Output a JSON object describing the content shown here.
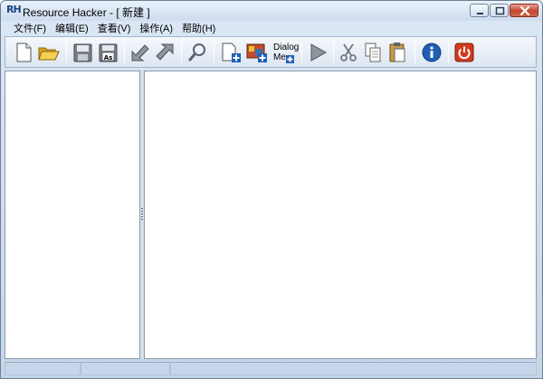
{
  "window": {
    "app_name": "Resource Hacker",
    "title": "Resource Hacker - [ 新建 ]"
  },
  "menu": [
    {
      "label": "文件(F)"
    },
    {
      "label": "编辑(E)"
    },
    {
      "label": "查看(V)"
    },
    {
      "label": "操作(A)"
    },
    {
      "label": "帮助(H)"
    }
  ],
  "toolbar": {
    "dialog_menu_line1": "Dialog",
    "dialog_menu_line2": "Me",
    "icons": [
      "new-file-icon",
      "open-folder-icon",
      "save-icon",
      "save-as-icon",
      "import-icon",
      "export-icon",
      "find-icon",
      "add-resource-icon",
      "add-image-icon",
      "add-dialog-menu-icon",
      "run-script-icon",
      "cut-icon",
      "copy-icon",
      "paste-icon",
      "about-icon",
      "exit-icon"
    ]
  },
  "colors": {
    "accent_blue": "#1f5fb4",
    "exit_red": "#d23a1e",
    "save_gray": "#7a7f86"
  }
}
